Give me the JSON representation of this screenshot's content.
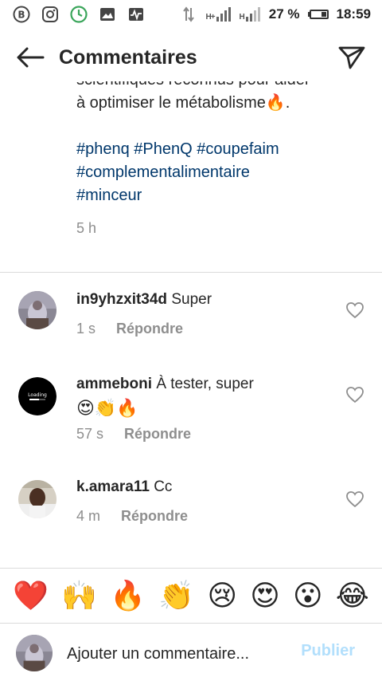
{
  "status_bar": {
    "network_1": "H+",
    "network_2": "H",
    "battery": "27 %",
    "battery_level": 0.27,
    "time": "18:59",
    "app_icons": [
      "b-logo-icon",
      "instagram-icon",
      "clock-icon",
      "image-icon",
      "activity-icon"
    ]
  },
  "header": {
    "title": "Commentaires"
  },
  "post": {
    "caption_lines": [
      "scientifiques reconnus pour aider",
      "à optimiser le métabolisme🔥."
    ],
    "hashtags_line1": "#phenq  #PhenQ #coupefaim",
    "hashtags_line2": "#complementalimentaire",
    "hashtags_line3": "#minceur",
    "time": "5 h"
  },
  "comments": [
    {
      "username": "in9yhzxit34d",
      "text": "Super",
      "emojis": "",
      "time": "1 s",
      "reply_label": "Répondre"
    },
    {
      "username": "ammeboni",
      "text": "À tester, super",
      "emojis": "😍👏🔥",
      "time": "57 s",
      "reply_label": "Répondre"
    },
    {
      "username": "k.amara11",
      "text": "Cc",
      "emojis": "",
      "time": "4 m",
      "reply_label": "Répondre"
    }
  ],
  "emoji_bar": [
    "❤️",
    "🙌",
    "🔥",
    "👏",
    "😢",
    "😍",
    "😮",
    "😂"
  ],
  "input": {
    "placeholder": "Ajouter un commentaire...",
    "publish_label": "Publier"
  },
  "colors": {
    "hashtag": "#00376b",
    "meta": "#8e8e8e",
    "publish": "#b2dffc"
  }
}
